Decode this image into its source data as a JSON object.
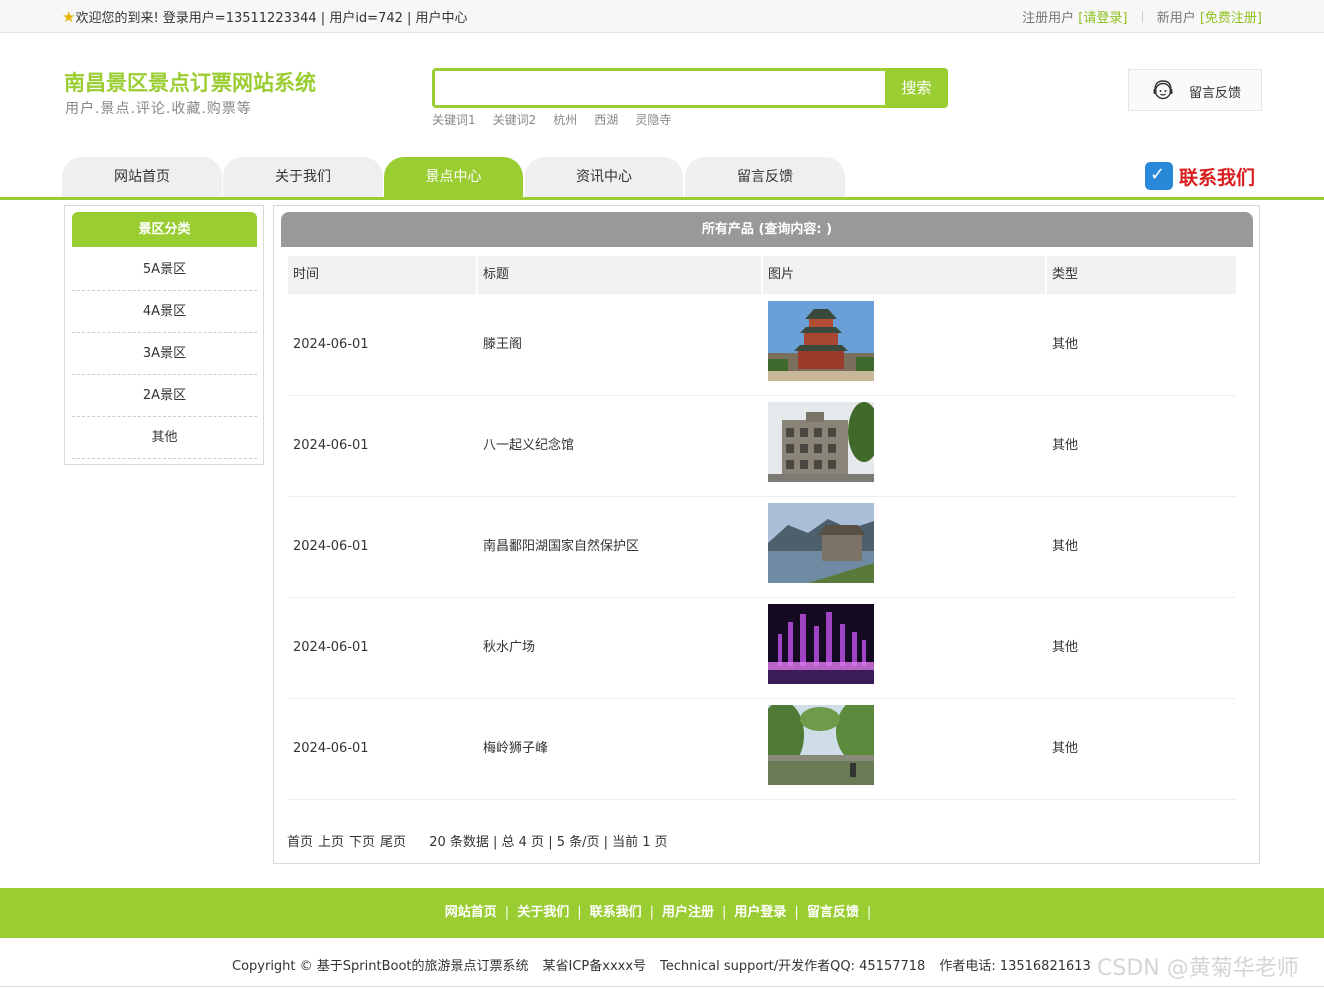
{
  "topbar": {
    "welcome": "欢迎您的到来!  登录用户=13511223344 | 用户id=742 | 用户中心",
    "register_label": "注册用户",
    "login_link": "[请登录]",
    "new_user_label": "新用户",
    "free_register_link": "[免费注册]"
  },
  "header": {
    "title": "南昌景区景点订票网站系统",
    "subtitle": "用户.景点.评论.收藏.购票等",
    "search": {
      "value": "",
      "button": "搜索"
    },
    "keywords": [
      "关键词1",
      "关键词2",
      "杭州",
      "西湖",
      "灵隐寺"
    ],
    "feedback": "留言反馈"
  },
  "nav": {
    "tabs": [
      "网站首页",
      "关于我们",
      "景点中心",
      "资讯中心",
      "留言反馈"
    ],
    "active": 2,
    "contact": "联系我们"
  },
  "sidebar": {
    "title": "景区分类",
    "items": [
      "5A景区",
      "4A景区",
      "3A景区",
      "2A景区",
      "其他"
    ]
  },
  "main": {
    "title": "所有产品 (查询内容: )",
    "columns": [
      "时间",
      "标题",
      "图片",
      "类型"
    ],
    "rows": [
      {
        "date": "2024-06-01",
        "title": "滕王阁",
        "type": "其他",
        "image": "pavilion"
      },
      {
        "date": "2024-06-01",
        "title": "八一起义纪念馆",
        "type": "其他",
        "image": "building"
      },
      {
        "date": "2024-06-01",
        "title": "南昌鄱阳湖国家自然保护区",
        "type": "其他",
        "image": "lake"
      },
      {
        "date": "2024-06-01",
        "title": "秋水广场",
        "type": "其他",
        "image": "fountain"
      },
      {
        "date": "2024-06-01",
        "title": "梅岭狮子峰",
        "type": "其他",
        "image": "forest"
      }
    ],
    "pager": {
      "links": [
        "首页",
        "上页",
        "下页",
        "尾页"
      ],
      "info": "20 条数据 | 总 4 页 | 5 条/页 | 当前 1 页"
    }
  },
  "footer": {
    "links": [
      "网站首页",
      "关于我们",
      "联系我们",
      "用户注册",
      "用户登录",
      "留言反馈"
    ],
    "copyright": "Copyright © 基于SprintBoot的旅游景点订票系统",
    "icp": "某省ICP备xxxx号",
    "support": "Technical support/开发作者QQ:  45157718",
    "phone": "作者电话:  13516821613",
    "watermark": "CSDN @黄菊华老师"
  },
  "colors": {
    "accent": "#9acd32",
    "panel_header": "#999999",
    "contact_red": "#d81e1e"
  }
}
